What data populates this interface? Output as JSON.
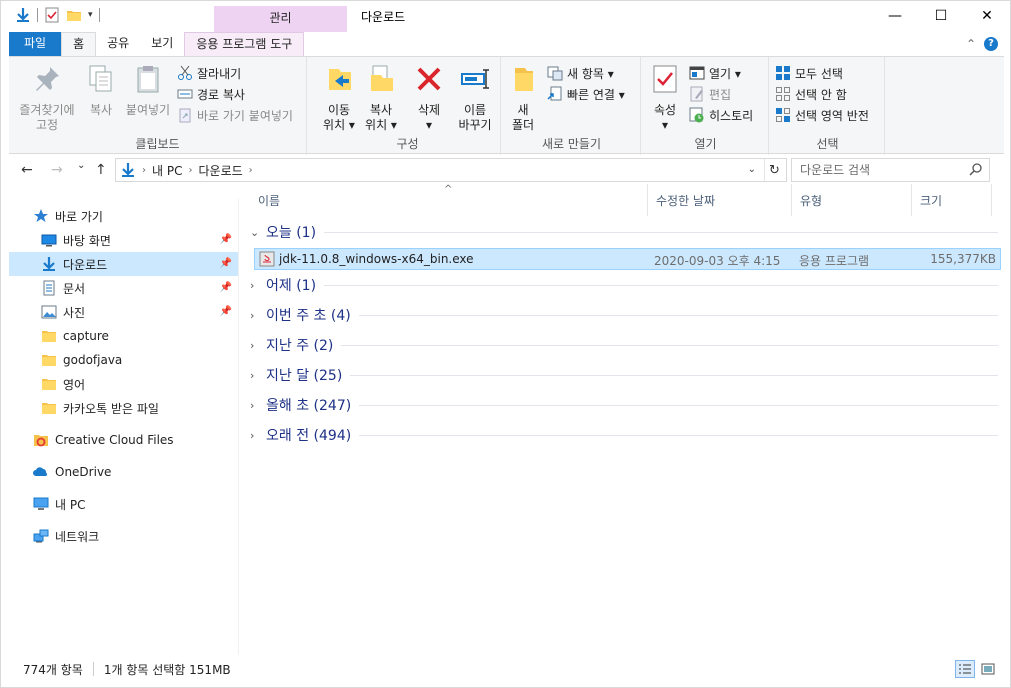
{
  "window": {
    "title": "다운로드",
    "contextual_tab_group": "관리",
    "controls": {
      "minimize": "—",
      "maximize": "☐",
      "close": "✕"
    }
  },
  "ribbon": {
    "tabs": [
      {
        "label": "파일"
      },
      {
        "label": "홈"
      },
      {
        "label": "공유"
      },
      {
        "label": "보기"
      },
      {
        "label": "응용 프로그램 도구"
      }
    ],
    "collapse_glyph": "⌃",
    "help_glyph": "?",
    "groups": {
      "clipboard": {
        "label": "클립보드",
        "pin_quick_line1": "즐겨찾기에",
        "pin_quick_line2": "고정",
        "copy": "복사",
        "paste": "붙여넣기",
        "cut": "잘라내기",
        "copy_path": "경로 복사",
        "paste_shortcut": "바로 가기 붙여넣기"
      },
      "organize": {
        "label": "구성",
        "move_to_line1": "이동",
        "move_to_line2": "위치 ▾",
        "copy_to_line1": "복사",
        "copy_to_line2": "위치 ▾",
        "delete_line1": "삭제",
        "delete_line2": "▾",
        "rename_line1": "이름",
        "rename_line2": "바꾸기"
      },
      "new": {
        "label": "새로 만들기",
        "new_folder_line1": "새",
        "new_folder_line2": "폴더",
        "new_item": "새 항목 ▾",
        "easy_access": "빠른 연결 ▾"
      },
      "open": {
        "label": "열기",
        "properties_line1": "속성",
        "properties_line2": "▾",
        "open": "열기 ▾",
        "edit": "편집",
        "history": "히스토리"
      },
      "select": {
        "label": "선택",
        "select_all": "모두 선택",
        "select_none": "선택 안 함",
        "invert_selection": "선택 영역 반전"
      }
    }
  },
  "navigation": {
    "back_glyph": "←",
    "forward_glyph": "→",
    "dropdown_glyph": "⌄",
    "up_glyph": "↑",
    "breadcrumb": [
      "내 PC",
      "다운로드"
    ],
    "crumb_sep": "›",
    "addr_dropdown_glyph": "⌄",
    "refresh_glyph": "↻",
    "search_placeholder": "다운로드 검색"
  },
  "nav_pane": {
    "items": [
      {
        "label": "바로 가기",
        "icon": "star-icon",
        "pinned": false
      },
      {
        "label": "바탕 화면",
        "icon": "desktop-icon",
        "pinned": true
      },
      {
        "label": "다운로드",
        "icon": "download-icon",
        "pinned": true,
        "selected": true
      },
      {
        "label": "문서",
        "icon": "document-icon",
        "pinned": true
      },
      {
        "label": "사진",
        "icon": "pictures-icon",
        "pinned": true
      },
      {
        "label": "capture",
        "icon": "folder-icon"
      },
      {
        "label": "godofjava",
        "icon": "folder-icon"
      },
      {
        "label": "영어",
        "icon": "folder-icon"
      },
      {
        "label": "카카오톡 받은 파일",
        "icon": "folder-icon"
      },
      {
        "label": "Creative Cloud Files",
        "icon": "creative-cloud-icon"
      },
      {
        "label": "OneDrive",
        "icon": "onedrive-icon"
      },
      {
        "label": "내 PC",
        "icon": "pc-icon"
      },
      {
        "label": "네트워크",
        "icon": "network-icon"
      }
    ]
  },
  "file_list": {
    "columns": {
      "name": "이름",
      "date": "수정한 날짜",
      "type": "유형",
      "size": "크기"
    },
    "sort_glyph": "^",
    "groups": [
      {
        "label": "오늘 (1)",
        "expanded": true
      },
      {
        "label": "어제 (1)",
        "expanded": false
      },
      {
        "label": "이번 주 초 (4)",
        "expanded": false
      },
      {
        "label": "지난 주 (2)",
        "expanded": false
      },
      {
        "label": "지난 달 (25)",
        "expanded": false
      },
      {
        "label": "올해 초 (247)",
        "expanded": false
      },
      {
        "label": "오래 전 (494)",
        "expanded": false
      }
    ],
    "expanded_glyph": "⌄",
    "collapsed_glyph": "›",
    "files": [
      {
        "name": "jdk-11.0.8_windows-x64_bin.exe",
        "date": "2020-09-03 오후 4:15",
        "type": "응용 프로그램",
        "size": "155,377KB",
        "selected": true
      }
    ]
  },
  "status_bar": {
    "item_count": "774개 항목",
    "selection": "1개 항목 선택함 151MB"
  },
  "colors": {
    "accent": "#1979ca",
    "selection_bg": "#cce8ff",
    "group_header_text": "#1e3287",
    "context_tab": "#eed4f2"
  }
}
